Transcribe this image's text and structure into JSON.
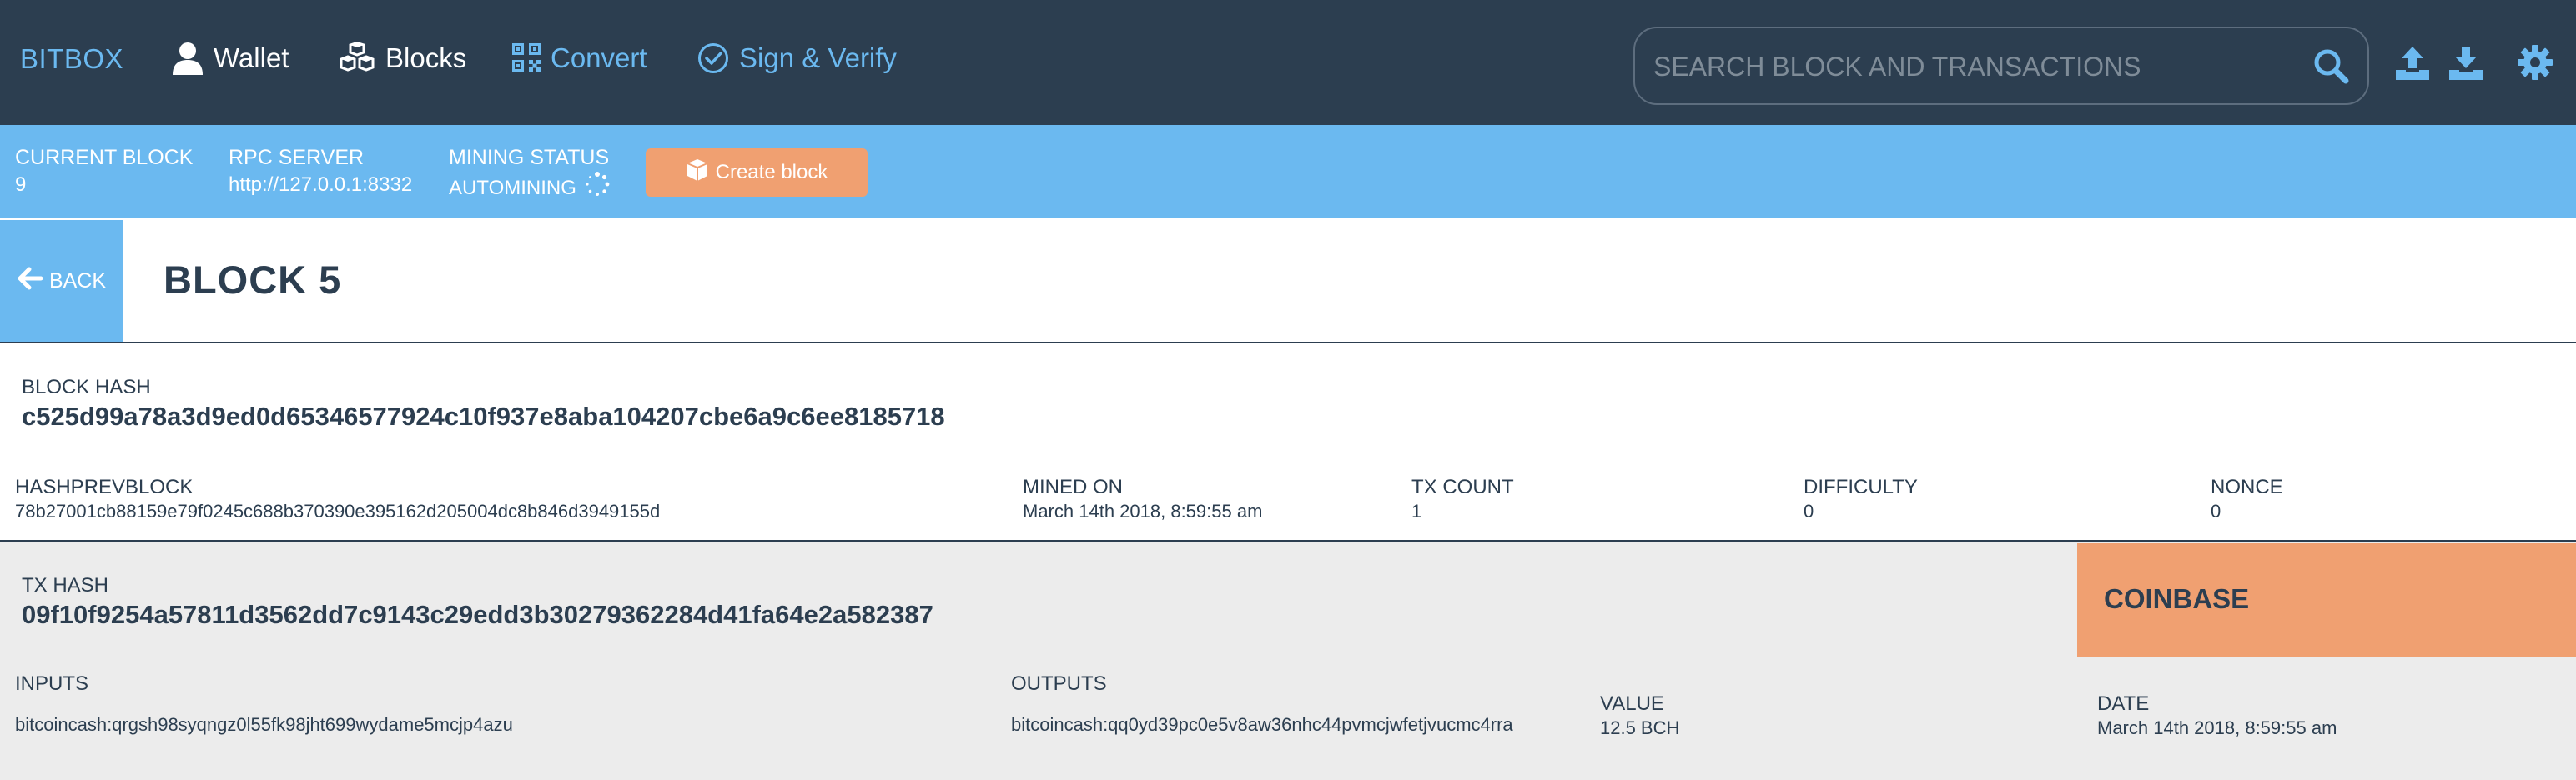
{
  "nav": {
    "brand": "BITBOX",
    "wallet": "Wallet",
    "blocks": "Blocks",
    "convert": "Convert",
    "sign_verify": "Sign & Verify"
  },
  "search": {
    "placeholder": "SEARCH BLOCK AND TRANSACTIONS"
  },
  "status": {
    "current_block_label": "CURRENT BLOCK",
    "current_block_value": "9",
    "rpc_label": "RPC SERVER",
    "rpc_value": "http://127.0.0.1:8332",
    "mining_label": "MINING STATUS",
    "mining_value": "AUTOMINING",
    "create_block": "Create block"
  },
  "block": {
    "back": "BACK",
    "title": "BLOCK 5",
    "hash_label": "BLOCK HASH",
    "hash": "c525d99a78a3d9ed0d65346577924c10f937e8aba104207cbe6a9c6ee8185718",
    "prev_label": "HASHPREVBLOCK",
    "prev": "78b27001cb88159e79f0245c688b370390e395162d205004dc8b846d3949155d",
    "mined_label": "MINED ON",
    "mined": "March 14th 2018, 8:59:55 am",
    "txcount_label": "TX COUNT",
    "txcount": "1",
    "difficulty_label": "DIFFICULTY",
    "difficulty": "0",
    "nonce_label": "NONCE",
    "nonce": "0"
  },
  "tx": {
    "hash_label": "TX HASH",
    "hash": "09f10f9254a57811d3562dd7c9143c29edd3b30279362284d41fa64e2a582387",
    "badge": "COINBASE",
    "inputs_label": "INPUTS",
    "input": "bitcoincash:qrgsh98syqngz0l55fk98jht699wydame5mcjp4azu",
    "outputs_label": "OUTPUTS",
    "output": "bitcoincash:qq0yd39pc0e5v8aw36nhc44pvmcjwfetjvucmc4rra",
    "value_label": "VALUE",
    "value": "12.5 BCH",
    "date_label": "DATE",
    "date": "March 14th 2018, 8:59:55 am"
  },
  "colors": {
    "nav_bg": "#2c3e50",
    "accent_blue": "#6bb9f0",
    "accent_orange": "#f0a071",
    "tx_bg": "#ececec"
  },
  "icons": {
    "wallet": "user-icon",
    "blocks": "cubes-icon",
    "convert": "qrcode-icon",
    "sign_verify": "check-circle-icon",
    "search": "search-icon",
    "upload": "upload-icon",
    "download": "download-icon",
    "settings": "gear-icon",
    "mining": "spinner-icon",
    "create_block": "cube-icon",
    "back": "arrow-left-icon"
  }
}
